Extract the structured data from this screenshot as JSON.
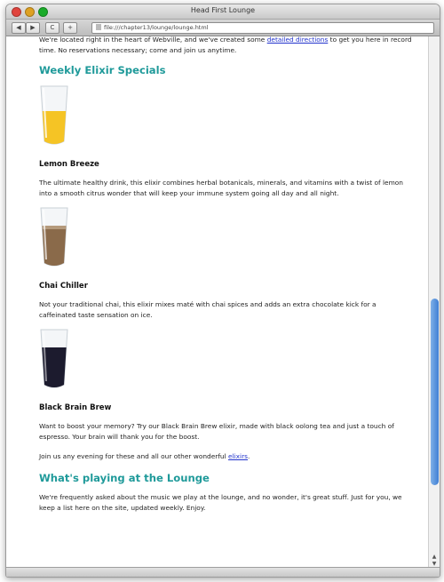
{
  "window": {
    "title": "Head First Lounge"
  },
  "toolbar": {
    "back_label": "◀",
    "forward_label": "▶",
    "reload_label": "C",
    "add_label": "+",
    "address": "file:///chapter13/lounge/lounge.html"
  },
  "page": {
    "intro_line1": "We're located right in the heart of Webville, and we've created some",
    "intro_link": "detailed directions",
    "intro_line2": "to get you here in record time. No reservations necessary; come and join us anytime.",
    "specials_heading": "Weekly Elixir Specials",
    "drinks": [
      {
        "name": "Lemon Breeze",
        "description": "The ultimate healthy drink, this elixir combines herbal botanicals, minerals, and vitamins with a twist of lemon into a smooth citrus wonder that will keep your immune system going all day and all night.",
        "color": "#f5c425"
      },
      {
        "name": "Chai Chiller",
        "description": "Not your traditional chai, this elixir mixes maté with chai spices and adds an extra chocolate kick for a caffeinated taste sensation on ice.",
        "color": "#8a6a4a"
      },
      {
        "name": "Black Brain Brew",
        "description": "Want to boost your memory? Try our Black Brain Brew elixir, made with black oolong tea and just a touch of espresso. Your brain will thank you for the boost.",
        "color": "#1c1b2e"
      }
    ],
    "join_text_before": "Join us any evening for these and all our other wonderful",
    "join_link": "elixirs",
    "join_text_after": ".",
    "music_heading": "What's playing at the Lounge",
    "music_text": "We're frequently asked about the music we play at the lounge, and no wonder, it's great stuff. Just for you, we keep a list here on the site, updated weekly. Enjoy."
  }
}
